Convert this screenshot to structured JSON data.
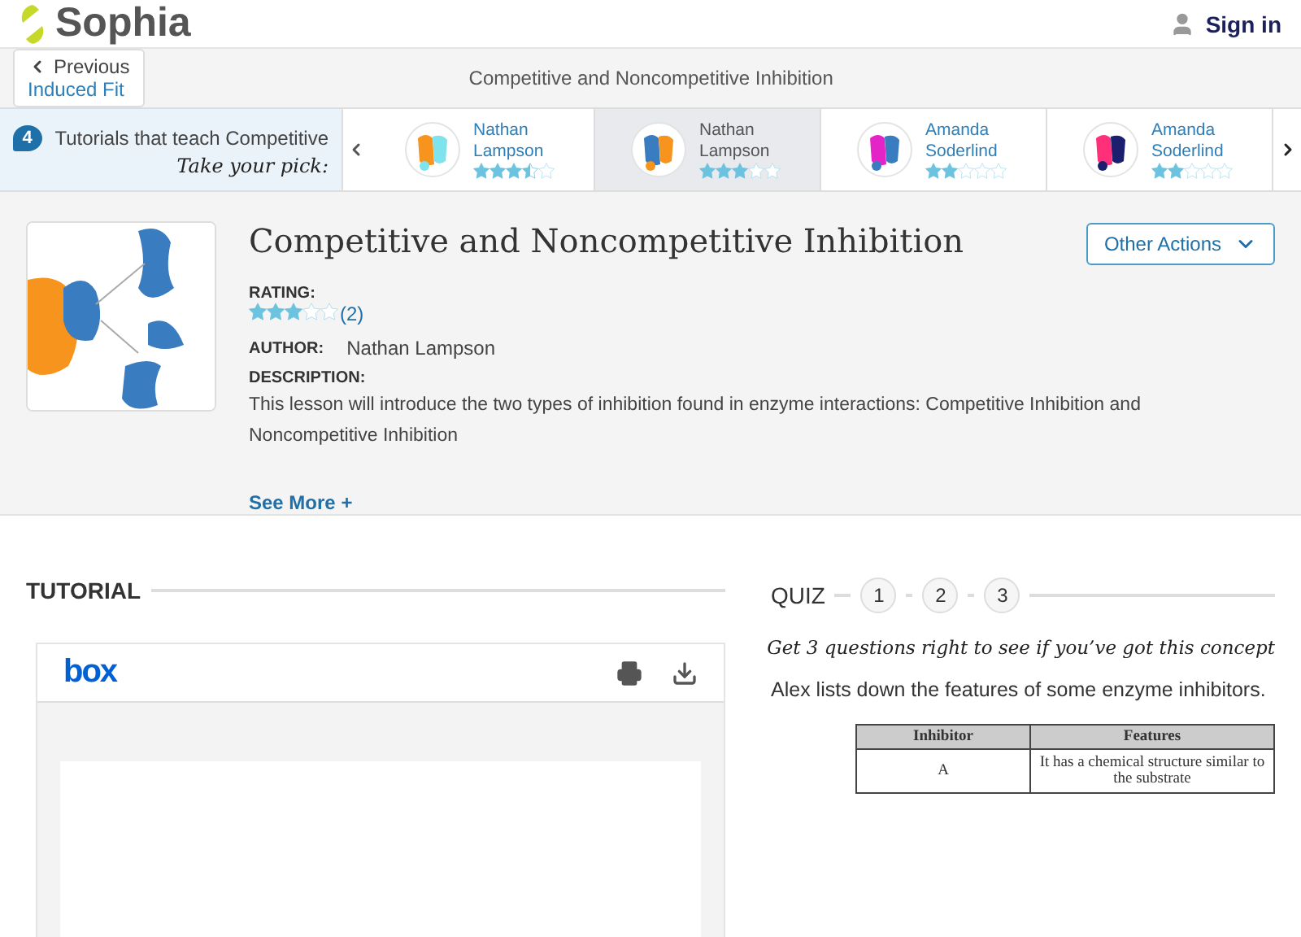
{
  "header": {
    "logo": "Sophia",
    "sign_in": "Sign in"
  },
  "nav": {
    "previous": {
      "label": "Previous",
      "title": "Induced Fit"
    },
    "page_title": "Competitive and Noncompetitive Inhibition"
  },
  "tutorials": {
    "count": "4",
    "heading": "Tutorials that teach Competitive",
    "tagline": "Take your pick:",
    "cards": [
      {
        "name": "Nathan Lampson",
        "stars": 3.5,
        "selected": false
      },
      {
        "name": "Nathan Lampson",
        "stars": 3,
        "selected": true
      },
      {
        "name": "Amanda Soderlind",
        "stars": 2,
        "selected": false
      },
      {
        "name": "Amanda Soderlind",
        "stars": 2,
        "selected": false
      }
    ]
  },
  "lesson": {
    "title": "Competitive and Noncompetitive Inhibition",
    "actions": "Other Actions",
    "rating_label": "RATING:",
    "stars": 3,
    "rating_count": "(2)",
    "author_label": "AUTHOR:",
    "author": "Nathan Lampson",
    "description_label": "DESCRIPTION:",
    "description": "This lesson will introduce the two types of inhibition found in enzyme interactions: Competitive Inhibition and Noncompetitive Inhibition",
    "see_more": "See More +"
  },
  "tutorial": {
    "heading": "TUTORIAL",
    "viewer": {
      "logo": "box"
    }
  },
  "quiz": {
    "heading": "QUIZ",
    "steps": [
      {
        "label": "1"
      },
      {
        "label": "2"
      },
      {
        "label": "3"
      }
    ],
    "prompt": "Get 3 questions right to see if you’ve got this concept",
    "question": "Alex lists down the features of some enzyme inhibitors.",
    "table": {
      "columns": [
        "Inhibitor",
        "Features"
      ],
      "rows": [
        [
          "A",
          "It has a chemical structure similar to the substrate"
        ]
      ]
    }
  }
}
